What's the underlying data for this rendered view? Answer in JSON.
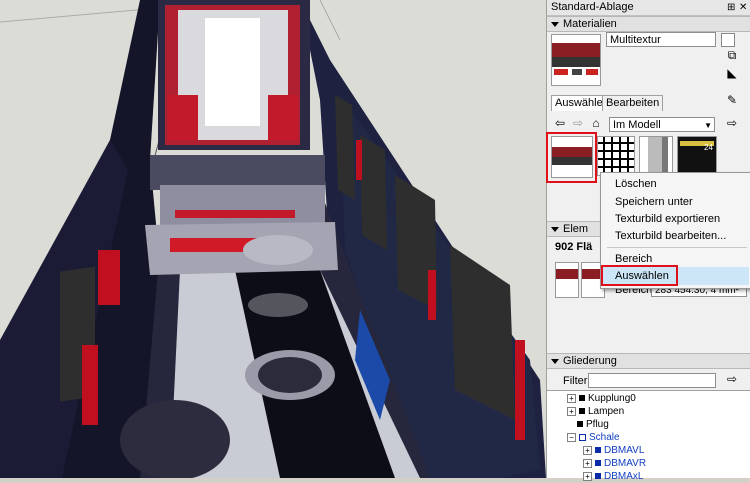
{
  "tray": {
    "title": "Standard-Ablage",
    "pin": "⊞",
    "close": "✕"
  },
  "materials": {
    "header": "Materialien",
    "name_value": "Multitextur",
    "tabs": [
      "Auswählen",
      "Bearbeiten"
    ],
    "library_value": "Im Modell",
    "thumb4_text": "24"
  },
  "context_menu": {
    "items": [
      "Löschen",
      "Speichern unter",
      "Texturbild exportieren",
      "Texturbild bearbeiten...",
      "Bereich",
      "Auswählen"
    ]
  },
  "entity_info": {
    "header": "Elem",
    "count_text": "902 Flä",
    "field_label": "Bereich:",
    "field_value": "283 454.30, 4 mm²"
  },
  "outline": {
    "header": "Gliederung",
    "filter_label": "Filter:",
    "items": [
      "Kupplung0",
      "Lampen",
      "Pflug",
      "Schale",
      "DBMAVL",
      "DBMAVR",
      "DBMAxL"
    ]
  },
  "colors": {
    "accent_red": "#e0101a",
    "menu_highlight": "#cde6f7",
    "selected_blue": "#1240c0"
  }
}
